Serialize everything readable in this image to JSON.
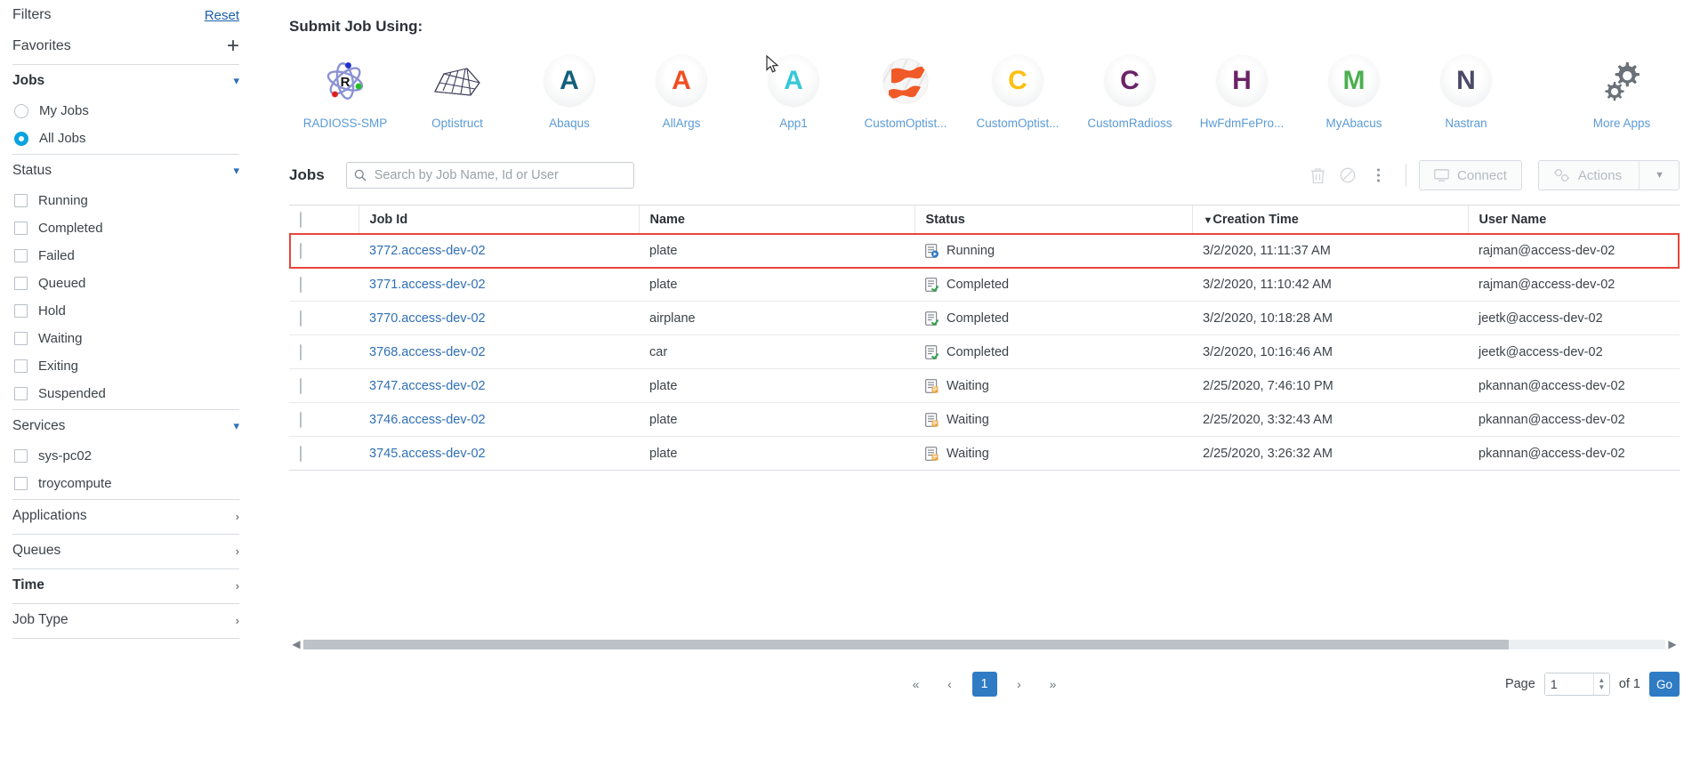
{
  "sidebar": {
    "filters_label": "Filters",
    "reset_label": "Reset",
    "favorites_label": "Favorites",
    "add_icon": "+",
    "jobs_group": {
      "label": "Jobs",
      "options": [
        {
          "label": "My Jobs",
          "selected": false
        },
        {
          "label": "All Jobs",
          "selected": true
        }
      ]
    },
    "status_group": {
      "label": "Status",
      "options": [
        "Running",
        "Completed",
        "Failed",
        "Queued",
        "Hold",
        "Waiting",
        "Exiting",
        "Suspended"
      ]
    },
    "services_group": {
      "label": "Services",
      "options": [
        "sys-pc02",
        "troycompute"
      ]
    },
    "collapsed_sections": [
      {
        "label": "Applications",
        "bold": false
      },
      {
        "label": "Queues",
        "bold": false
      },
      {
        "label": "Time",
        "bold": true
      },
      {
        "label": "Job Type",
        "bold": false
      }
    ]
  },
  "main": {
    "submit_title": "Submit Job Using:",
    "apps": [
      {
        "label": "RADIOSS-SMP",
        "glyph": "R",
        "color": "#1b1b1b",
        "style": "atom"
      },
      {
        "label": "Optistruct",
        "glyph": "",
        "color": "#3b3b55",
        "style": "mesh"
      },
      {
        "label": "Abaqus",
        "glyph": "A",
        "color": "#13607a",
        "style": "letter"
      },
      {
        "label": "AllArgs",
        "glyph": "A",
        "color": "#f04e23",
        "style": "letter"
      },
      {
        "label": "App1",
        "glyph": "A",
        "color": "#36c8d6",
        "style": "letter"
      },
      {
        "label": "CustomOptist...",
        "glyph": "",
        "color": "#f05a28",
        "style": "altair"
      },
      {
        "label": "CustomOptist...",
        "glyph": "C",
        "color": "#fcc010",
        "style": "letter"
      },
      {
        "label": "CustomRadioss",
        "glyph": "C",
        "color": "#6b2367",
        "style": "letter"
      },
      {
        "label": "HwFdmFePro...",
        "glyph": "H",
        "color": "#6b2367",
        "style": "letter"
      },
      {
        "label": "MyAbacus",
        "glyph": "M",
        "color": "#4caf50",
        "style": "letter"
      },
      {
        "label": "Nastran",
        "glyph": "N",
        "color": "#4a4a6a",
        "style": "letter"
      }
    ],
    "more_apps": {
      "label": "More Apps",
      "icon": "gears-icon"
    },
    "toolbar": {
      "jobs_label": "Jobs",
      "search_placeholder": "Search by Job Name, Id or User",
      "search_value": "",
      "delete_icon": "trash-icon",
      "cancel_icon": "ban-icon",
      "more_icon": "kebab-menu-icon",
      "connect_label": "Connect",
      "actions_label": "Actions"
    },
    "table": {
      "columns": [
        "Job Id",
        "Name",
        "Status",
        "Creation Time",
        "User Name"
      ],
      "sorted_column": "Creation Time",
      "sort_indicator": "▼",
      "highlighted_row_index": 0,
      "highlight_color": "#e8453c",
      "rows": [
        {
          "job_id": "3772.access-dev-02",
          "name": "plate",
          "status": "Running",
          "creation_time": "3/2/2020, 11:11:37 AM",
          "user_name": "rajman@access-dev-02"
        },
        {
          "job_id": "3771.access-dev-02",
          "name": "plate",
          "status": "Completed",
          "creation_time": "3/2/2020, 11:10:42 AM",
          "user_name": "rajman@access-dev-02"
        },
        {
          "job_id": "3770.access-dev-02",
          "name": "airplane",
          "status": "Completed",
          "creation_time": "3/2/2020, 10:18:28 AM",
          "user_name": "jeetk@access-dev-02"
        },
        {
          "job_id": "3768.access-dev-02",
          "name": "car",
          "status": "Completed",
          "creation_time": "3/2/2020, 10:16:46 AM",
          "user_name": "jeetk@access-dev-02"
        },
        {
          "job_id": "3747.access-dev-02",
          "name": "plate",
          "status": "Waiting",
          "creation_time": "2/25/2020, 7:46:10 PM",
          "user_name": "pkannan@access-dev-02"
        },
        {
          "job_id": "3746.access-dev-02",
          "name": "plate",
          "status": "Waiting",
          "creation_time": "2/25/2020, 3:32:43 AM",
          "user_name": "pkannan@access-dev-02"
        },
        {
          "job_id": "3745.access-dev-02",
          "name": "plate",
          "status": "Waiting",
          "creation_time": "2/25/2020, 3:26:32 AM",
          "user_name": "pkannan@access-dev-02"
        }
      ]
    },
    "pagination": {
      "first_label": "«",
      "prev_label": "‹",
      "current_page": "1",
      "next_label": "›",
      "last_label": "»",
      "page_label": "Page",
      "page_input_value": "1",
      "of_label": "of 1",
      "go_label": "Go"
    }
  }
}
